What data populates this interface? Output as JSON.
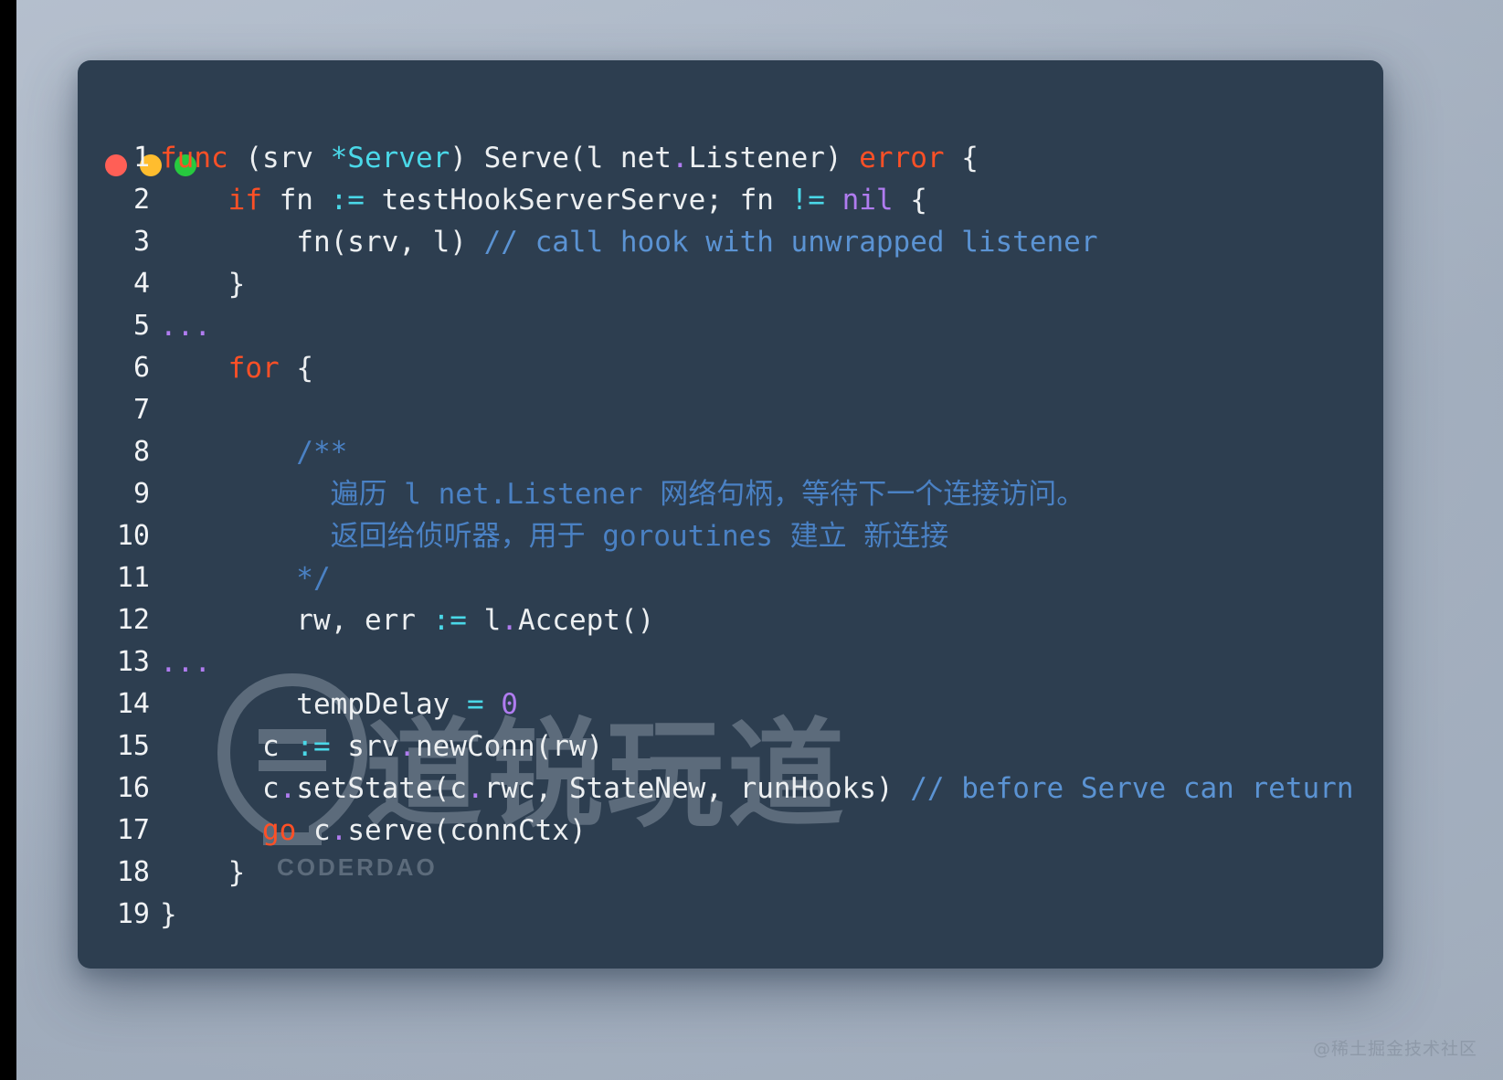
{
  "window": {
    "controls": [
      {
        "name": "close",
        "color": "#ff5f56"
      },
      {
        "name": "minimize",
        "color": "#ffbd2e"
      },
      {
        "name": "maximize",
        "color": "#27c93f"
      }
    ]
  },
  "theme": {
    "background": "#a9b5c5",
    "panel": "#2d3e50",
    "text": "#eceff1",
    "keyword": "#ff5026",
    "type": "#4ad8e8",
    "operator": "#4ad8e8",
    "number": "#b07cf0",
    "comment": "#5b93d3",
    "line_number": "#f2f4f6"
  },
  "watermark": {
    "text": "道锐玩道",
    "subtext": "CODERDAO"
  },
  "attribution": "@稀土掘金技术社区",
  "code": {
    "language": "go",
    "lines": [
      {
        "n": "1",
        "tokens": [
          {
            "t": "func",
            "c": "kw"
          },
          {
            "t": " (srv ",
            "c": "pln"
          },
          {
            "t": "*Server",
            "c": "typ"
          },
          {
            "t": ") Serve(l net",
            "c": "pln"
          },
          {
            "t": ".",
            "c": "dot2"
          },
          {
            "t": "Listener) ",
            "c": "pln"
          },
          {
            "t": "error",
            "c": "kw"
          },
          {
            "t": " {",
            "c": "pln"
          }
        ]
      },
      {
        "n": "2",
        "tokens": [
          {
            "t": "    ",
            "c": "pln"
          },
          {
            "t": "if",
            "c": "kw"
          },
          {
            "t": " fn ",
            "c": "pln"
          },
          {
            "t": ":=",
            "c": "op"
          },
          {
            "t": " testHookServerServe; fn ",
            "c": "pln"
          },
          {
            "t": "!=",
            "c": "op"
          },
          {
            "t": " ",
            "c": "pln"
          },
          {
            "t": "nil",
            "c": "num"
          },
          {
            "t": " {",
            "c": "pln"
          }
        ]
      },
      {
        "n": "3",
        "tokens": [
          {
            "t": "        fn(srv, l) ",
            "c": "pln"
          },
          {
            "t": "// call hook with unwrapped listener",
            "c": "cmt"
          }
        ]
      },
      {
        "n": "4",
        "tokens": [
          {
            "t": "    }",
            "c": "pln"
          }
        ]
      },
      {
        "n": "5",
        "tokens": [
          {
            "t": "...",
            "c": "ell"
          }
        ]
      },
      {
        "n": "6",
        "tokens": [
          {
            "t": "    ",
            "c": "pln"
          },
          {
            "t": "for",
            "c": "kw"
          },
          {
            "t": " {",
            "c": "pln"
          }
        ]
      },
      {
        "n": "7",
        "tokens": [
          {
            "t": "",
            "c": "pln"
          }
        ]
      },
      {
        "n": "8",
        "tokens": [
          {
            "t": "        /**",
            "c": "cmt2"
          }
        ]
      },
      {
        "n": "9",
        "tokens": [
          {
            "t": "          遍历 l net.Listener 网络句柄，等待下一个连接访问。",
            "c": "cmt2"
          }
        ]
      },
      {
        "n": "10",
        "tokens": [
          {
            "t": "          返回给侦听器，用于 goroutines 建立 新连接",
            "c": "cmt2"
          }
        ]
      },
      {
        "n": "11",
        "tokens": [
          {
            "t": "        */",
            "c": "cmt2"
          }
        ]
      },
      {
        "n": "12",
        "tokens": [
          {
            "t": "        rw, err ",
            "c": "pln"
          },
          {
            "t": ":=",
            "c": "op"
          },
          {
            "t": " l",
            "c": "pln"
          },
          {
            "t": ".",
            "c": "dot2"
          },
          {
            "t": "Accept()",
            "c": "pln"
          }
        ]
      },
      {
        "n": "13",
        "tokens": [
          {
            "t": "...",
            "c": "ell"
          }
        ]
      },
      {
        "n": "14",
        "tokens": [
          {
            "t": "        tempDelay ",
            "c": "pln"
          },
          {
            "t": "=",
            "c": "op"
          },
          {
            "t": " ",
            "c": "pln"
          },
          {
            "t": "0",
            "c": "num"
          }
        ]
      },
      {
        "n": "15",
        "tokens": [
          {
            "t": "      c ",
            "c": "pln"
          },
          {
            "t": ":=",
            "c": "op"
          },
          {
            "t": " srv",
            "c": "pln"
          },
          {
            "t": ".",
            "c": "dot2"
          },
          {
            "t": "newConn(rw)",
            "c": "pln"
          }
        ]
      },
      {
        "n": "16",
        "tokens": [
          {
            "t": "      c",
            "c": "pln"
          },
          {
            "t": ".",
            "c": "dot2"
          },
          {
            "t": "setState(c",
            "c": "pln"
          },
          {
            "t": ".",
            "c": "dot2"
          },
          {
            "t": "rwc, StateNew, runHooks) ",
            "c": "pln"
          },
          {
            "t": "// before Serve can return",
            "c": "cmt"
          }
        ]
      },
      {
        "n": "17",
        "tokens": [
          {
            "t": "      ",
            "c": "pln"
          },
          {
            "t": "go",
            "c": "kw"
          },
          {
            "t": " c",
            "c": "pln"
          },
          {
            "t": ".",
            "c": "dot2"
          },
          {
            "t": "serve(connCtx)",
            "c": "pln"
          }
        ]
      },
      {
        "n": "18",
        "tokens": [
          {
            "t": "    }",
            "c": "pln"
          }
        ]
      },
      {
        "n": "19",
        "tokens": [
          {
            "t": "}",
            "c": "pln"
          }
        ]
      }
    ]
  }
}
